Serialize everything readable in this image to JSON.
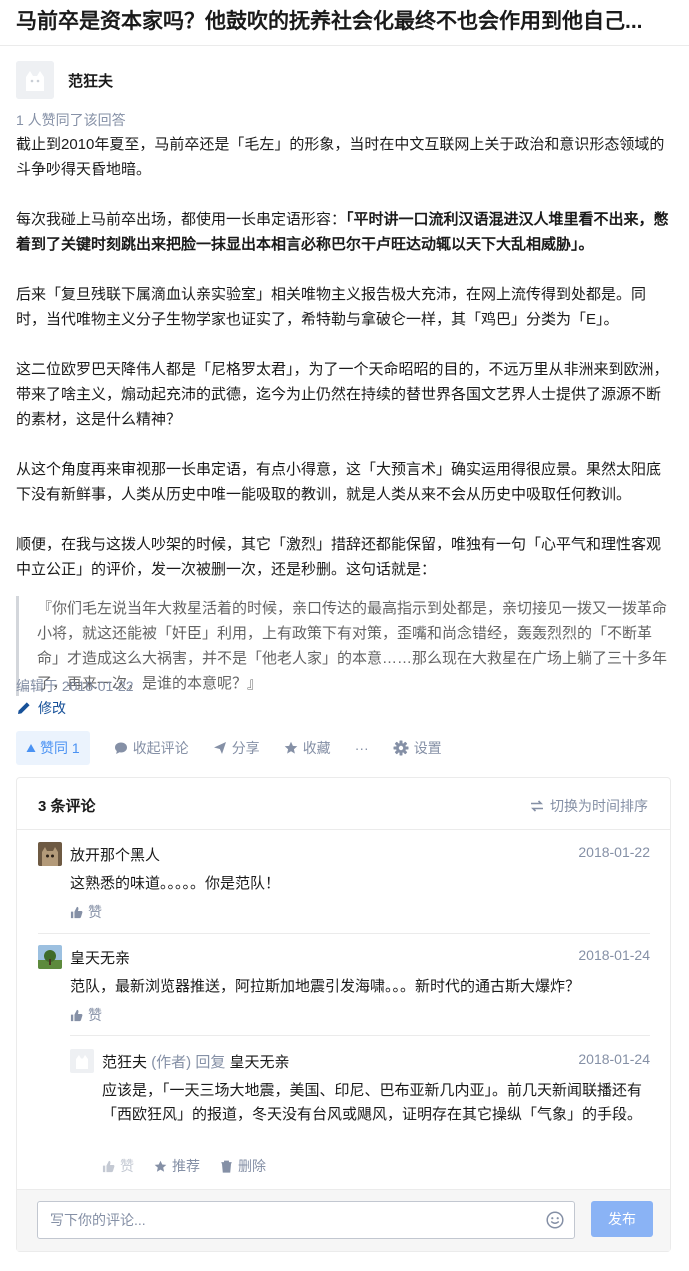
{
  "question": {
    "title": "马前卒是资本家吗？他鼓吹的抚养社会化最终不也会作用到他自己..."
  },
  "answer": {
    "author": "范狂夫",
    "vote_note": "1 人赞同了该回答",
    "p1": "截止到2010年夏至，马前卒还是「毛左」的形象，当时在中文互联网上关于政治和意识形态领域的斗争吵得天昏地暗。",
    "p2_prefix": "每次我碰上马前卒出场，都使用一长串定语形容：",
    "p2_bold": "「平时讲一口流利汉语混进汉人堆里看不出来，憋着到了关键时刻跳出来把脸一抹显出本相言必称巴尔干卢旺达动辄以天下大乱相威胁」。",
    "p3": "后来「复旦残联下属滴血认亲实验室」相关唯物主义报告极大充沛，在网上流传得到处都是。同时，当代唯物主义分子生物学家也证实了，希特勒与拿破仑一样，其「鸡巴」分类为「E」。",
    "p4": "这二位欧罗巴天降伟人都是「尼格罗太君」，为了一个天命昭昭的目的，不远万里从非洲来到欧洲，带来了啥主义，煽动起充沛的武德，迄今为止仍然在持续的替世界各国文艺界人士提供了源源不断的素材，这是什么精神？",
    "p5": "从这个角度再来审视那一长串定语，有点小得意，这「大预言术」确实运用得很应景。果然太阳底下没有新鲜事，人类从历史中唯一能吸取的教训，就是人类从来不会从历史中吸取任何教训。",
    "p6": "顺便，在我与这拨人吵架的时候，其它「激烈」措辞还都能保留，唯独有一句「心平气和理性客观中立公正」的评价，发一次被删一次，还是秒删。这句话就是：",
    "quote": "『你们毛左说当年大救星活着的时候，亲口传达的最高指示到处都是，亲切接见一拨又一拨革命小将，就这还能被「奸臣」利用，上有政策下有对策，歪嘴和尚念错经，轰轰烈烈的「不断革命」才造成这么大祸害，并不是「他老人家」的本意……那么现在大救星在广场上躺了三十多年了，再来一次，是谁的本意呢？』",
    "edited": "编辑于 2018-01-22",
    "modify": "修改"
  },
  "actions": {
    "vote": "赞同 1",
    "collapse_comments": "收起评论",
    "share": "分享",
    "favorite": "收藏",
    "more": "···",
    "settings": "设置"
  },
  "comments": {
    "count_label": "3 条评论",
    "sort_label": "切换为时间排序",
    "items": [
      {
        "name": "放开那个黑人",
        "date": "2018-01-22",
        "text": "这熟悉的味道。。。。。你是范队！",
        "like": "赞"
      },
      {
        "name": "皇天无亲",
        "date": "2018-01-24",
        "text": "范队，最新浏览器推送，阿拉斯加地震引发海啸。。。新时代的通古斯大爆炸？",
        "like": "赞"
      }
    ],
    "reply": {
      "name": "范狂夫",
      "author_tag": "(作者)",
      "reply_word": "回复",
      "reply_to": "皇天无亲",
      "date": "2018-01-24",
      "text": "应该是，「一天三场大地震，美国、印尼、巴布亚新几内亚」。前几天新闻联播还有「西欧狂风」的报道，冬天没有台风或飓风，证明存在其它操纵「气象」的手段。",
      "like": "赞",
      "recommend": "推荐",
      "delete": "删除"
    },
    "input_placeholder": "写下你的评论...",
    "submit": "发布"
  },
  "colors": {
    "brand_blue": "#0084ff",
    "vote_bg": "#ebf3fd",
    "muted": "#8590a6",
    "link": "#175199"
  },
  "icons": [
    "edit-icon",
    "triangle-up-icon",
    "comment-icon",
    "share-icon",
    "star-icon",
    "gear-icon",
    "switch-icon",
    "thumb-up-icon",
    "delete-icon",
    "emoji-icon"
  ]
}
